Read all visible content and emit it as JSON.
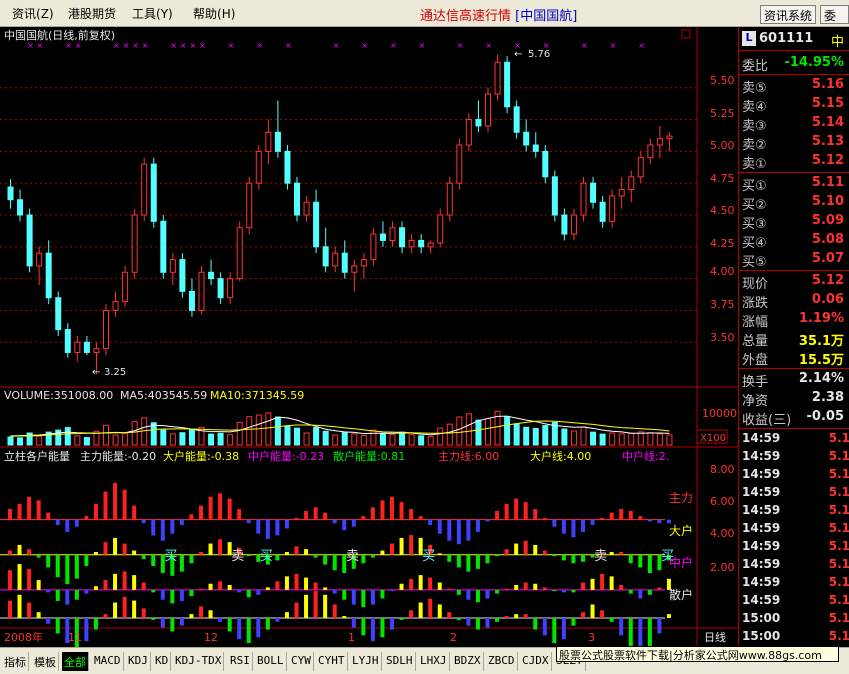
{
  "menu": {
    "items": [
      "资讯",
      "港股期货",
      "工具",
      "帮助"
    ],
    "mnemonics": [
      "(Z)",
      "(Y)",
      "(H)"
    ],
    "app_title": "通达信高速行情",
    "stock_title": "[中国国航]",
    "info_button": "资讯系统",
    "overflow_button": "委"
  },
  "chart": {
    "title": "中国国航(日线,前复权)",
    "price_ticks": [
      "5.50",
      "5.25",
      "5.00",
      "4.75",
      "4.50",
      "4.25",
      "4.00",
      "3.75",
      "3.50"
    ],
    "high_label": "5.76",
    "low_label": "3.25",
    "vol_label": "VOLUME:351008.00",
    "ma5_label": "MA5:403545.59",
    "ma10_label": "MA10:371345.59",
    "vol_tick": "10000",
    "vol_unit": "X100",
    "ind_title": "立柱各户能量",
    "ind_main": "主力能量:-0.20",
    "ind_big": "大户能量:-0.38",
    "ind_mid": "中户能量:-0.23",
    "ind_retail": "散户能量:0.81",
    "ind_main_line": "主力线:6.00",
    "ind_big_line": "大户线:4.00",
    "ind_mid_line": "中户线:2.",
    "ind_ticks": [
      "8.00",
      "6.00",
      "4.00",
      "2.00"
    ],
    "ind_right_labels": [
      "主力",
      "大户",
      "中户",
      "散户"
    ],
    "signals": [
      "买",
      "卖",
      "买",
      "卖",
      "买",
      "卖",
      "买"
    ],
    "date_labels": [
      "2008年",
      "11",
      "12",
      "1",
      "2",
      "3"
    ],
    "period": "日线"
  },
  "side": {
    "code_badge": "L",
    "code": "601111",
    "code_suffix": "中",
    "webi_label": "委比",
    "webi_value": "-14.95%",
    "asks": [
      {
        "label": "卖⑤",
        "price": "5.16"
      },
      {
        "label": "卖④",
        "price": "5.15"
      },
      {
        "label": "卖③",
        "price": "5.14"
      },
      {
        "label": "卖②",
        "price": "5.13"
      },
      {
        "label": "卖①",
        "price": "5.12"
      }
    ],
    "bids": [
      {
        "label": "买①",
        "price": "5.11"
      },
      {
        "label": "买②",
        "price": "5.10"
      },
      {
        "label": "买③",
        "price": "5.09"
      },
      {
        "label": "买④",
        "price": "5.08"
      },
      {
        "label": "买⑤",
        "price": "5.07"
      }
    ],
    "stats": [
      {
        "label": "现价",
        "value": "5.12"
      },
      {
        "label": "涨跌",
        "value": "0.06"
      },
      {
        "label": "涨幅",
        "value": "1.19%"
      },
      {
        "label": "总量",
        "value": "35.1万"
      },
      {
        "label": "外盘",
        "value": "15.5万"
      }
    ],
    "extra": [
      {
        "label": "换手",
        "value": "2.14%"
      },
      {
        "label": "净资",
        "value": "2.38"
      },
      {
        "label": "收益(三)",
        "value": "-0.05"
      }
    ],
    "ticks": [
      {
        "time": "14:59",
        "price": "5.1"
      },
      {
        "time": "14:59",
        "price": "5.1"
      },
      {
        "time": "14:59",
        "price": "5.1"
      },
      {
        "time": "14:59",
        "price": "5.1"
      },
      {
        "time": "14:59",
        "price": "5.1"
      },
      {
        "time": "14:59",
        "price": "5.1"
      },
      {
        "time": "14:59",
        "price": "5.1"
      },
      {
        "time": "14:59",
        "price": "5.1"
      },
      {
        "time": "14:59",
        "price": "5.1"
      },
      {
        "time": "14:59",
        "price": "5.1"
      },
      {
        "time": "15:00",
        "price": "5.1"
      },
      {
        "time": "15:00",
        "price": "5.1"
      }
    ]
  },
  "tabs": [
    "指标",
    "模板",
    "全部",
    "MACD",
    "KDJ",
    "KD",
    "KDJ-TDX",
    "RSI",
    "BOLL",
    "CYW",
    "CYHT",
    "LYJH",
    "SDLH",
    "LHXJ",
    "BDZX",
    "ZBCD",
    "CJDX",
    "SLZT"
  ],
  "banner": "股票公式股票软件下载|分析家公式网www.88gs.com",
  "colors": {
    "up": "#ff3232",
    "down": "#54ffff",
    "grid": "#b00000",
    "ma5": "#ffffff",
    "ma10": "#ffff00"
  },
  "chart_data": {
    "type": "candlestick",
    "price_range": [
      3.18,
      5.82
    ],
    "candles": [
      [
        4.72,
        4.78,
        4.55,
        4.62
      ],
      [
        4.62,
        4.7,
        4.45,
        4.5
      ],
      [
        4.5,
        4.55,
        4.05,
        4.1
      ],
      [
        4.1,
        4.25,
        3.95,
        4.2
      ],
      [
        4.2,
        4.3,
        3.8,
        3.85
      ],
      [
        3.85,
        3.9,
        3.55,
        3.6
      ],
      [
        3.6,
        3.65,
        3.38,
        3.42
      ],
      [
        3.42,
        3.55,
        3.35,
        3.5
      ],
      [
        3.5,
        3.55,
        3.4,
        3.42
      ],
      [
        3.42,
        3.5,
        3.25,
        3.45
      ],
      [
        3.45,
        3.8,
        3.4,
        3.75
      ],
      [
        3.75,
        3.9,
        3.7,
        3.82
      ],
      [
        3.82,
        4.1,
        3.78,
        4.05
      ],
      [
        4.05,
        4.55,
        4.0,
        4.5
      ],
      [
        4.5,
        4.95,
        4.45,
        4.9
      ],
      [
        4.9,
        4.95,
        4.4,
        4.45
      ],
      [
        4.45,
        4.5,
        4.0,
        4.05
      ],
      [
        4.05,
        4.2,
        3.95,
        4.15
      ],
      [
        4.15,
        4.2,
        3.85,
        3.9
      ],
      [
        3.9,
        4.0,
        3.7,
        3.75
      ],
      [
        3.75,
        4.1,
        3.72,
        4.05
      ],
      [
        4.05,
        4.15,
        3.95,
        4.0
      ],
      [
        4.0,
        4.05,
        3.8,
        3.85
      ],
      [
        3.85,
        4.05,
        3.8,
        4.0
      ],
      [
        4.0,
        4.45,
        3.98,
        4.4
      ],
      [
        4.4,
        4.8,
        4.35,
        4.75
      ],
      [
        4.75,
        5.05,
        4.7,
        5.0
      ],
      [
        5.0,
        5.25,
        4.9,
        5.15
      ],
      [
        5.15,
        5.4,
        4.95,
        5.0
      ],
      [
        5.0,
        5.05,
        4.7,
        4.75
      ],
      [
        4.75,
        4.8,
        4.45,
        4.5
      ],
      [
        4.5,
        4.65,
        4.45,
        4.6
      ],
      [
        4.6,
        4.7,
        4.2,
        4.25
      ],
      [
        4.25,
        4.4,
        4.05,
        4.1
      ],
      [
        4.1,
        4.25,
        4.05,
        4.2
      ],
      [
        4.2,
        4.3,
        4.0,
        4.05
      ],
      [
        4.05,
        4.15,
        3.9,
        4.1
      ],
      [
        4.1,
        4.2,
        4.0,
        4.15
      ],
      [
        4.15,
        4.4,
        4.1,
        4.35
      ],
      [
        4.35,
        4.45,
        4.25,
        4.3
      ],
      [
        4.3,
        4.45,
        4.25,
        4.4
      ],
      [
        4.4,
        4.45,
        4.2,
        4.25
      ],
      [
        4.25,
        4.35,
        4.2,
        4.3
      ],
      [
        4.3,
        4.35,
        4.2,
        4.25
      ],
      [
        4.25,
        4.3,
        4.2,
        4.28
      ],
      [
        4.28,
        4.55,
        4.25,
        4.5
      ],
      [
        4.5,
        4.8,
        4.45,
        4.75
      ],
      [
        4.75,
        5.1,
        4.7,
        5.05
      ],
      [
        5.05,
        5.3,
        5.0,
        5.25
      ],
      [
        5.25,
        5.4,
        5.15,
        5.2
      ],
      [
        5.2,
        5.5,
        5.15,
        5.45
      ],
      [
        5.45,
        5.76,
        5.4,
        5.7
      ],
      [
        5.7,
        5.75,
        5.3,
        5.35
      ],
      [
        5.35,
        5.4,
        5.1,
        5.15
      ],
      [
        5.15,
        5.25,
        5.0,
        5.05
      ],
      [
        5.05,
        5.15,
        4.95,
        5.0
      ],
      [
        5.0,
        5.05,
        4.75,
        4.8
      ],
      [
        4.8,
        4.85,
        4.45,
        4.5
      ],
      [
        4.5,
        4.55,
        4.3,
        4.35
      ],
      [
        4.35,
        4.55,
        4.3,
        4.5
      ],
      [
        4.5,
        4.8,
        4.45,
        4.75
      ],
      [
        4.75,
        4.8,
        4.55,
        4.6
      ],
      [
        4.6,
        4.65,
        4.4,
        4.45
      ],
      [
        4.45,
        4.7,
        4.4,
        4.65
      ],
      [
        4.65,
        4.8,
        4.55,
        4.7
      ],
      [
        4.7,
        4.85,
        4.6,
        4.8
      ],
      [
        4.8,
        5.0,
        4.75,
        4.95
      ],
      [
        4.95,
        5.1,
        4.9,
        5.05
      ],
      [
        5.05,
        5.2,
        4.95,
        5.1
      ],
      [
        5.1,
        5.15,
        5.0,
        5.12
      ]
    ],
    "volume_range": [
      0,
      14000
    ],
    "volume": [
      2800,
      2500,
      4200,
      3100,
      4500,
      5200,
      6100,
      3200,
      2600,
      4800,
      6900,
      3500,
      4100,
      8200,
      9500,
      7800,
      5200,
      3900,
      4300,
      5600,
      6200,
      3800,
      4100,
      3600,
      7900,
      9900,
      10500,
      11200,
      9800,
      6500,
      5900,
      4200,
      6100,
      4800,
      3500,
      4400,
      3900,
      3300,
      5200,
      4100,
      3700,
      4500,
      3600,
      3200,
      3000,
      5900,
      7300,
      9800,
      10900,
      8700,
      9200,
      11800,
      9900,
      7400,
      6200,
      5800,
      6800,
      7900,
      5600,
      4900,
      6300,
      4500,
      3800,
      4200,
      3900,
      4100,
      4600,
      4300,
      3900,
      3500
    ],
    "ma5": [
      3200,
      3300,
      3400,
      3500,
      3800,
      4200,
      4500,
      4300,
      4200,
      4100,
      4300,
      4400,
      4300,
      5000,
      6200,
      6900,
      6800,
      6400,
      6100,
      5500,
      5000,
      4700,
      4700,
      4600,
      5100,
      6200,
      7300,
      8400,
      9700,
      9500,
      8700,
      7500,
      6500,
      5500,
      5000,
      4600,
      4400,
      4000,
      4100,
      4100,
      4100,
      4200,
      4200,
      3800,
      3600,
      4000,
      4500,
      5500,
      7000,
      8500,
      9300,
      10000,
      10100,
      9400,
      8700,
      8200,
      7400,
      6800,
      6500,
      6200,
      6300,
      5800,
      5200,
      4800,
      4600,
      4100,
      4100,
      4200,
      4200,
      4050
    ],
    "ma10": [
      3100,
      3150,
      3200,
      3300,
      3500,
      3700,
      3900,
      4000,
      4100,
      4100,
      4200,
      4300,
      4300,
      4500,
      5000,
      5400,
      5600,
      5600,
      5700,
      5600,
      5500,
      5400,
      5300,
      5200,
      5300,
      5500,
      5700,
      6000,
      6400,
      6800,
      7000,
      7000,
      6900,
      6700,
      6400,
      6000,
      5700,
      5300,
      4900,
      4600,
      4500,
      4400,
      4300,
      4200,
      4100,
      4100,
      4200,
      4400,
      4800,
      5300,
      5800,
      6400,
      7000,
      7500,
      7900,
      8300,
      8400,
      8300,
      8100,
      7800,
      7500,
      7200,
      6800,
      6400,
      6100,
      5900,
      5700,
      5500,
      5300,
      4900
    ],
    "indicator_range": [
      0,
      9
    ],
    "energy_main": [
      0.6,
      0.9,
      1.3,
      1.1,
      0.4,
      -0.3,
      -0.7,
      -0.4,
      0.2,
      0.9,
      1.6,
      2.1,
      1.7,
      0.8,
      -0.2,
      -0.9,
      -1.2,
      -0.8,
      -0.3,
      0.3,
      0.8,
      1.3,
      1.5,
      1.2,
      0.6,
      -0.2,
      -0.8,
      -1.1,
      -0.9,
      -0.5,
      0.1,
      0.5,
      0.7,
      0.4,
      -0.2,
      -0.6,
      -0.4,
      0.2,
      0.7,
      1.1,
      1.3,
      1.0,
      0.6,
      0.2,
      -0.3,
      -0.8,
      -1.2,
      -1.4,
      -1.2,
      -0.7,
      -0.1,
      0.5,
      0.9,
      1.2,
      1.0,
      0.6,
      0.1,
      -0.4,
      -0.8,
      -1.0,
      -0.7,
      -0.3,
      0.1,
      0.4,
      0.6,
      0.5,
      0.2,
      -0.1,
      -0.2,
      -0.2
    ],
    "signals_idx": [
      8,
      15,
      18,
      27,
      35,
      53,
      60
    ]
  }
}
